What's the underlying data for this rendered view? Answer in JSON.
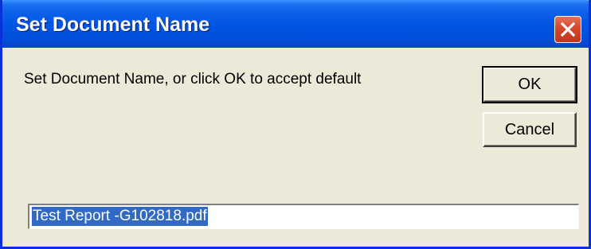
{
  "window": {
    "title": "Set Document Name",
    "close_icon": "close-x-icon",
    "title_bar_color": "#0054e3",
    "close_button_color": "#d5472a"
  },
  "dialog": {
    "prompt": "Set Document Name, or click OK to accept default",
    "ok_label": "OK",
    "cancel_label": "Cancel"
  },
  "name_field": {
    "value": "Test Report -G102818.pdf",
    "selected": true,
    "selection_color": "#316ac5"
  }
}
